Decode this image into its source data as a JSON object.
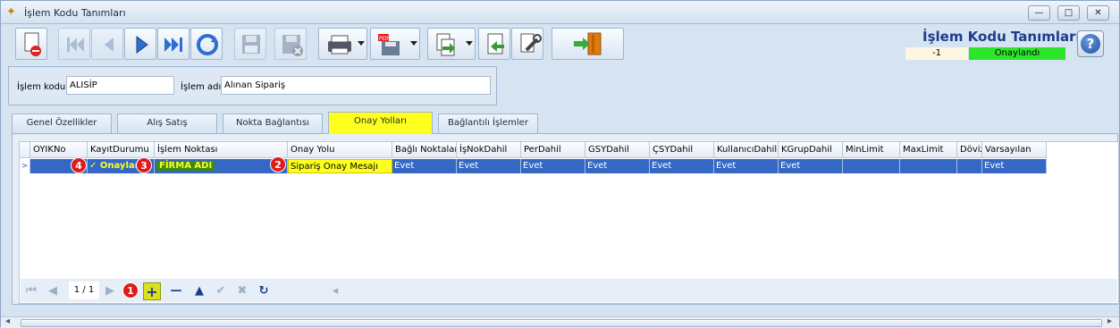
{
  "window": {
    "title": "İşlem Kodu Tanımları",
    "minimize": "—",
    "maximize": "□",
    "close": "✕"
  },
  "header": {
    "title": "İşlem Kodu Tanımları",
    "record_id": "-1",
    "status": "Onaylandı",
    "status_color": "#2ee52e"
  },
  "toolbar": {
    "icons": [
      "new-record-icon",
      "first-record-icon",
      "previous-record-icon",
      "next-record-icon",
      "last-record-icon",
      "refresh-icon",
      "save-icon",
      "cancel-save-icon",
      "print-icon",
      "pdf-export-icon",
      "export-icon",
      "import-icon",
      "settings-icon",
      "exit-icon",
      "help-icon"
    ]
  },
  "form": {
    "code_label": "İşlem kodu",
    "code_value": "ALISİP",
    "name_label": "İşlem adı",
    "name_value": "Alınan Sipariş"
  },
  "tabs": [
    {
      "label": "Genel Özellikler",
      "active": false
    },
    {
      "label": "Alış Satış",
      "active": false
    },
    {
      "label": "Nokta Bağlantısı",
      "active": false
    },
    {
      "label": "Onay Yolları",
      "active": true
    },
    {
      "label": "Bağlantılı İşlemler",
      "active": false
    }
  ],
  "grid": {
    "columns": [
      "OYIKNo",
      "KayıtDurumu",
      "İşlem Noktası",
      "Onay Yolu",
      "Bağlı Noktalar",
      "İşNokDahil",
      "PerDahil",
      "GSYDahil",
      "ÇSYDahil",
      "KullanıcıDahil",
      "KGrupDahil",
      "MinLimit",
      "MaxLimit",
      "Döviz",
      "Varsayılan"
    ],
    "rows": [
      [
        "",
        "✓ Onaylandı",
        "FİRMA ADI",
        "Sipariş Onay Mesajı",
        "Evet",
        "Evet",
        "Evet",
        "Evet",
        "Evet",
        "Evet",
        "Evet",
        "",
        "",
        "",
        "Evet"
      ]
    ],
    "row_indicator": ">",
    "highlight_color": "#ffff1e",
    "selection_color": "#3568c4"
  },
  "badges": [
    "1",
    "2",
    "3",
    "4"
  ],
  "navigator": {
    "first": "⏮",
    "prev": "◀",
    "count": "1 / 1",
    "next": "▶",
    "add": "+",
    "remove": "—",
    "up": "▲",
    "accept": "✔",
    "cancel": "✖",
    "refresh": "↻",
    "scroll_left": "◂"
  },
  "scrollbar": {
    "left": "◂",
    "right": "▸"
  }
}
